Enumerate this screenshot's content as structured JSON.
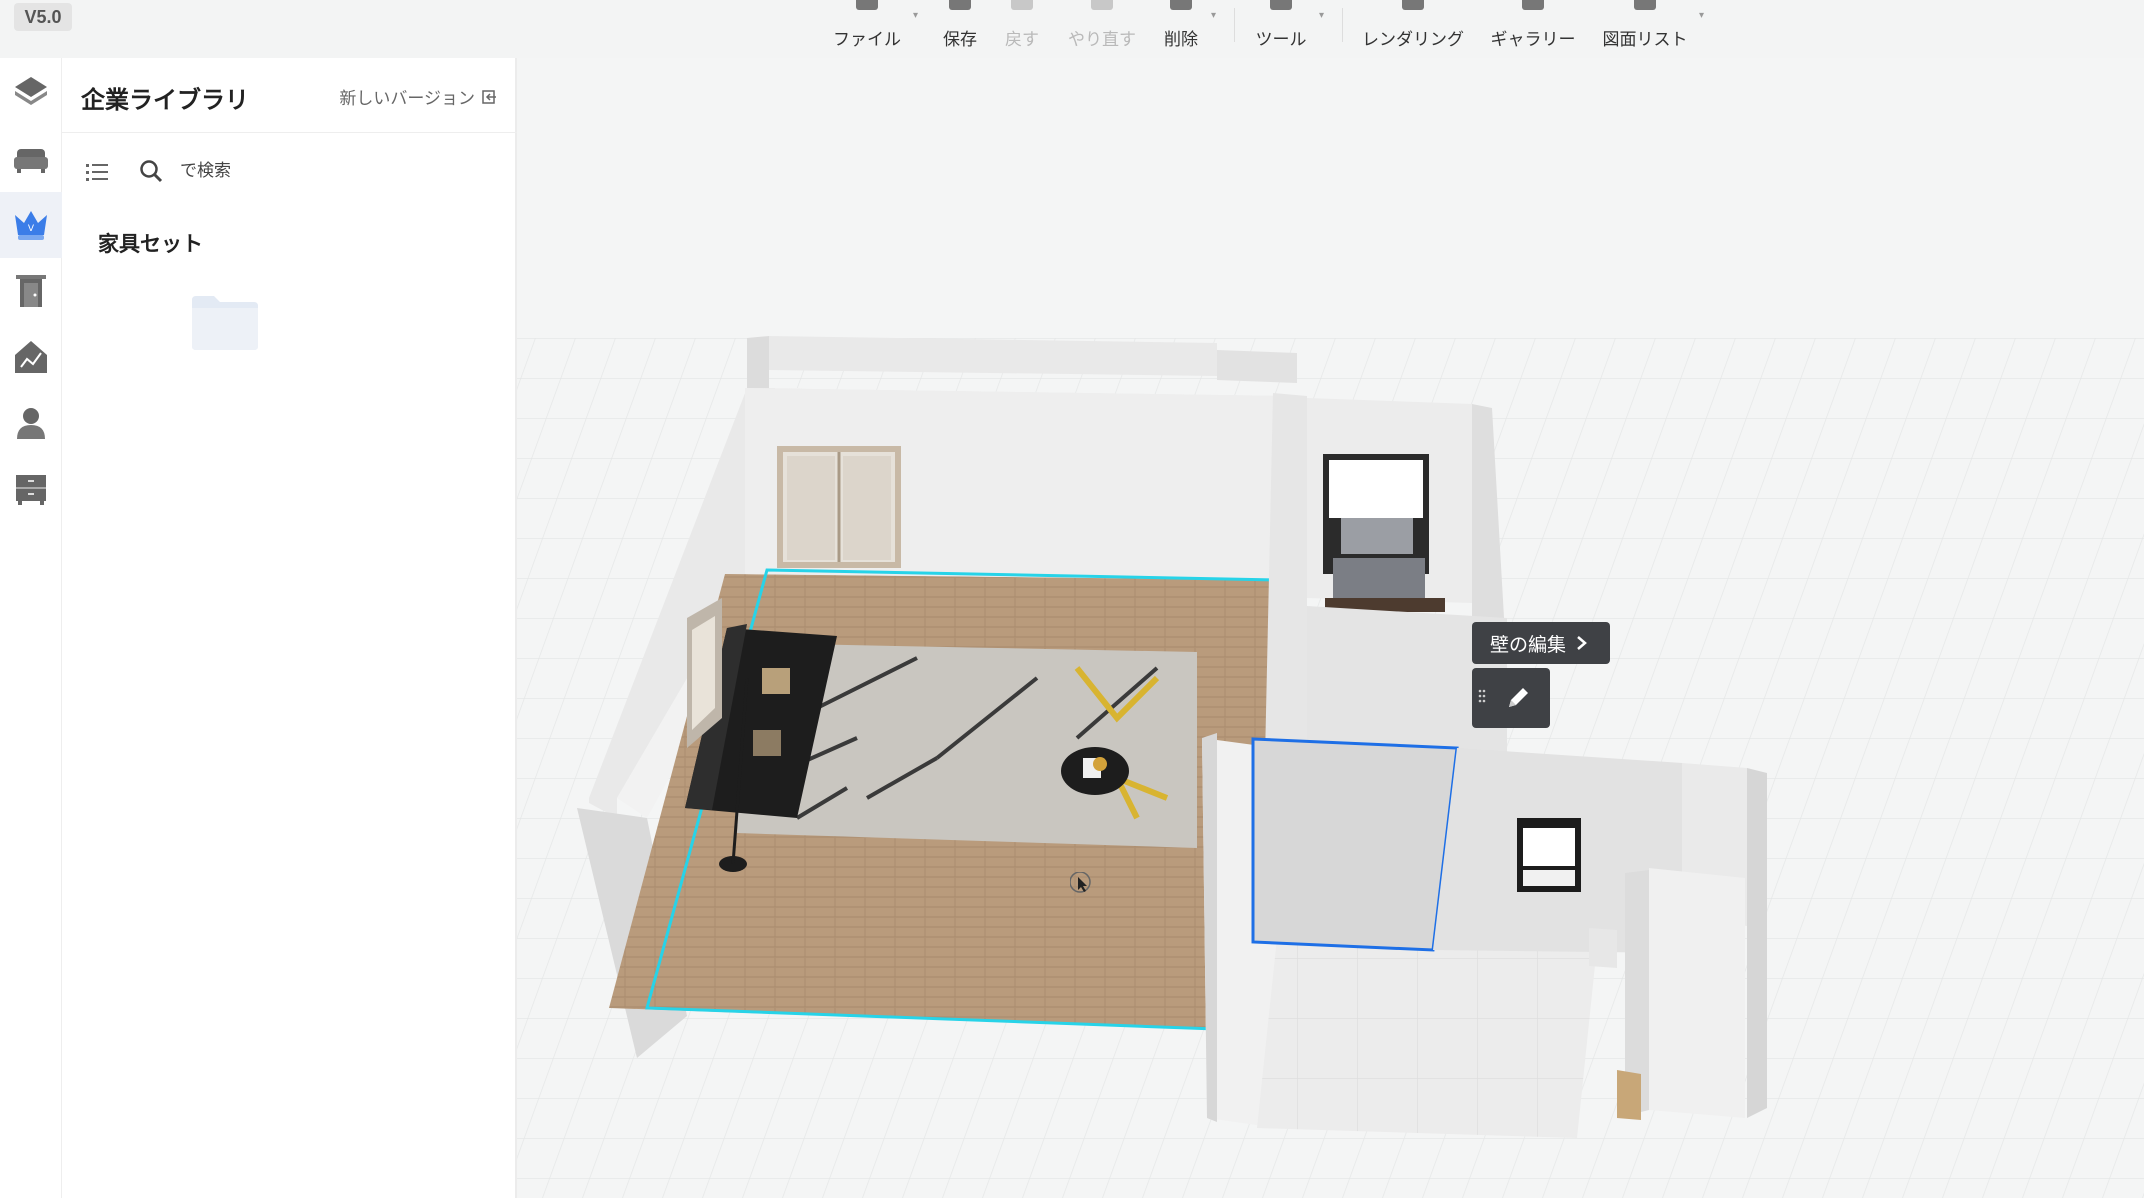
{
  "version": "V5.0",
  "toolbar": {
    "items": [
      {
        "label": "ファイル",
        "icon": "home-icon",
        "disabled": false,
        "caret": true
      },
      {
        "label": "保存",
        "icon": "save-icon",
        "disabled": false,
        "caret": false
      },
      {
        "label": "戻す",
        "icon": "undo-icon",
        "disabled": true,
        "caret": false
      },
      {
        "label": "やり直す",
        "icon": "redo-icon",
        "disabled": true,
        "caret": false
      },
      {
        "label": "削除",
        "icon": "eraser-icon",
        "disabled": false,
        "caret": true
      },
      {
        "label": "ツール",
        "icon": "wrench-icon",
        "disabled": false,
        "caret": true
      },
      {
        "label": "レンダリング",
        "icon": "render-icon",
        "disabled": false,
        "caret": false
      },
      {
        "label": "ギャラリー",
        "icon": "gallery-icon",
        "disabled": false,
        "caret": false
      },
      {
        "label": "図面リスト",
        "icon": "drawing-list-icon",
        "disabled": false,
        "caret": true
      }
    ]
  },
  "rail": {
    "items": [
      {
        "icon": "layers-icon",
        "active": false
      },
      {
        "icon": "sofa-icon",
        "active": false
      },
      {
        "icon": "crown-icon",
        "active": true
      },
      {
        "icon": "door-icon",
        "active": false
      },
      {
        "icon": "house-chart-icon",
        "active": false
      },
      {
        "icon": "person-icon",
        "active": false
      },
      {
        "icon": "cabinet-icon",
        "active": false
      }
    ]
  },
  "library": {
    "title": "企業ライブラリ",
    "new_version_label": "新しいバージョン",
    "search_placeholder": "で検索",
    "section_title": "家具セット"
  },
  "canvas": {
    "wall_edit_label": "壁の編集",
    "colors": {
      "selection_cyan": "#27d3e8",
      "selection_blue": "#1e6fe6",
      "floor_wood": "#b99b7c",
      "wall": "#e9e9e9",
      "grid": "#e3e5e5"
    }
  }
}
